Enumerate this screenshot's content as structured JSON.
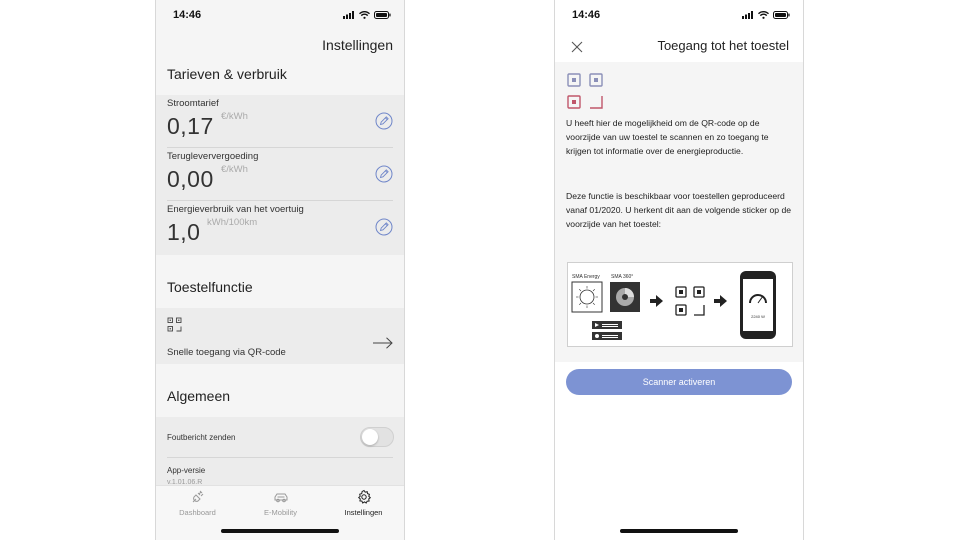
{
  "left": {
    "status_time": "14:46",
    "page_title": "Instellingen",
    "sections": {
      "tariffs_title": "Tarieven & verbruik",
      "device_title": "Toestelfunctie",
      "general_title": "Algemeen"
    },
    "rates": [
      {
        "label": "Stroomtarief",
        "value": "0,17",
        "unit": "€/kWh"
      },
      {
        "label": "Terugleververgoeding",
        "value": "0,00",
        "unit": "€/kWh"
      },
      {
        "label": "Energieverbruik van het voertuig",
        "value": "1,0",
        "unit": "kWh/100km"
      }
    ],
    "qr_access_label": "Snelle toegang via QR-code",
    "error_report_label": "Foutbericht zenden",
    "error_report_on": false,
    "app_version_label": "App-versie",
    "app_version_value": "v.1.01.06.R",
    "tabs": [
      {
        "label": "Dashboard",
        "icon": "plug-icon"
      },
      {
        "label": "E-Mobility",
        "icon": "car-icon"
      },
      {
        "label": "Instellingen",
        "icon": "gear-icon"
      }
    ],
    "accent_color": "#6f86c9"
  },
  "right": {
    "status_time": "14:46",
    "title": "Toegang tot het toestel",
    "paragraph1": "U heeft hier de mogelijkheid om de QR-code op de voorzijde van uw toestel te scannen en zo toegang te krijgen tot informatie over de energieproductie.",
    "paragraph2": "Deze functie is beschikbaar voor toestellen geproduceerd vanaf 01/2020. U herkent dit aan de volgende sticker op de voorzijde van het toestel:",
    "sticker": {
      "label_energy": "SMA Energy",
      "label_360": "SMA 360°",
      "phone_readout": "2240 W"
    },
    "button_label": "Scanner activeren",
    "button_color": "#7d93d3",
    "qr_icon_color": "#c0566a"
  }
}
